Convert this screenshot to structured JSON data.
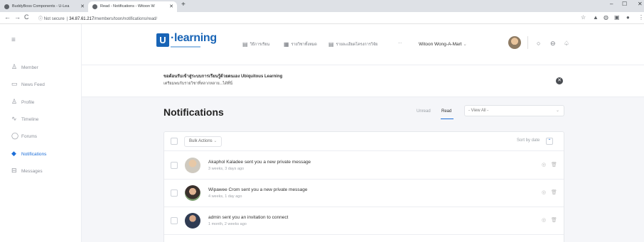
{
  "browser": {
    "tabs": [
      {
        "title": "BuddyBoss Components - U-Lea"
      },
      {
        "title": "Read - Notifications - Witoon W"
      }
    ],
    "url": {
      "security": "Not secure",
      "host": "34.87.61.217",
      "path": "/members/toon/notifications/read/"
    }
  },
  "brand": {
    "logo_letter": "U",
    "logo_text": "·learning",
    "color": "#1864b6",
    "accent": "#1c6ed8"
  },
  "header": {
    "menu": [
      {
        "label": "วิธีการเรียน",
        "icon": "document-icon"
      },
      {
        "label": "รายวิชาทั้งหมด",
        "icon": "grid-icon"
      },
      {
        "label": "รายละเอียดโครงการวิจัย",
        "icon": "document-icon"
      }
    ],
    "more": "···",
    "user_name": "Witoon Wong-A-Mart",
    "user_chevron": "⌄"
  },
  "sidebar": {
    "items": [
      {
        "label": "Member",
        "icon": "user-icon"
      },
      {
        "label": "News Feed",
        "icon": "feed-icon"
      },
      {
        "label": "Profile",
        "icon": "profile-icon"
      },
      {
        "label": "Timeline",
        "icon": "timeline-icon"
      },
      {
        "label": "Forums",
        "icon": "forums-icon"
      },
      {
        "label": "Notifications",
        "icon": "bell-icon",
        "active": true
      },
      {
        "label": "Messages",
        "icon": "inbox-icon"
      }
    ]
  },
  "welcome": {
    "line1": "ขอต้อนรับเข้าสู่ระบบการเรียนรู้ด้วยตนเอง Ubiquitous Learning",
    "line2": "เตรียมพบกับรายวิชาที่หลากหลาย...ได้ที่นี่"
  },
  "notifications": {
    "title": "Notifications",
    "filters": {
      "unread": "Unread",
      "read": "Read"
    },
    "view_all": "- View All -",
    "bulk_actions": "Bulk Actions",
    "bulk_chevron": "⌄",
    "sort_by": "Sort by date",
    "items": [
      {
        "text": "Akaphol Kaladee sent you a new private message",
        "time": "3 weeks, 3 days ago"
      },
      {
        "text": "Wipawee Crom sent you a new private message",
        "time": "4 weeks, 1 day ago"
      },
      {
        "text": "admin sent you an invitation to connect",
        "time": "1 month, 2 weeks ago"
      }
    ]
  }
}
